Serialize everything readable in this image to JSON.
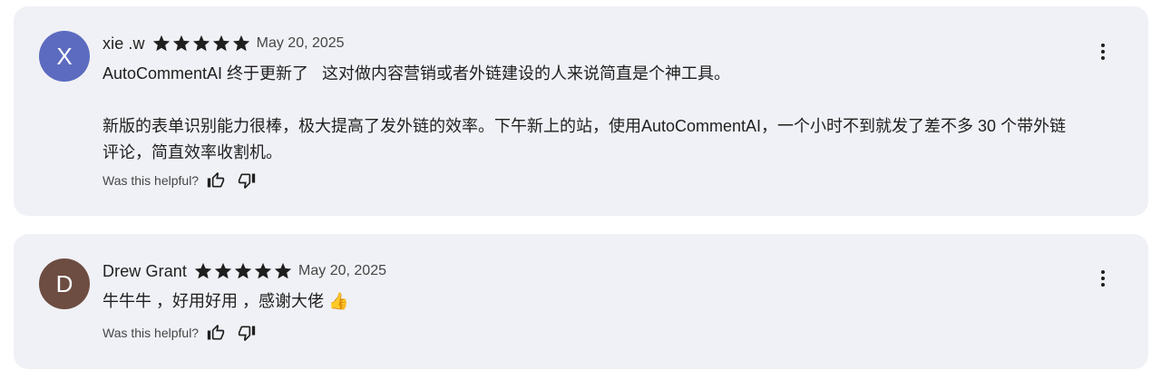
{
  "reviews": [
    {
      "avatar_letter": "X",
      "avatar_color": "#5c6bc0",
      "author": "xie .w",
      "rating": 5,
      "date": "May 20, 2025",
      "text": "AutoCommentAI 终于更新了   这对做内容营销或者外链建设的人来说简直是个神工具。\n\n新版的表单识别能力很棒，极大提高了发外链的效率。下午新上的站，使用AutoCommentAI，一个小时不到就发了差不多 30 个带外链评论，简直效率收割机。",
      "helpful_label": "Was this helpful?"
    },
    {
      "avatar_letter": "D",
      "avatar_color": "#6d4c41",
      "author": "Drew Grant",
      "rating": 5,
      "date": "May 20, 2025",
      "text": "牛牛牛 ，好用好用 ，感谢大佬 👍",
      "helpful_label": "Was this helpful?"
    }
  ],
  "icons": {
    "star": "star-icon",
    "thumb_up": "thumb-up-icon",
    "thumb_down": "thumb-down-icon",
    "more": "more-vert-icon"
  },
  "colors": {
    "card_bg": "#f0f1f6",
    "star": "#1f1f1f",
    "secondary_text": "#444746"
  }
}
